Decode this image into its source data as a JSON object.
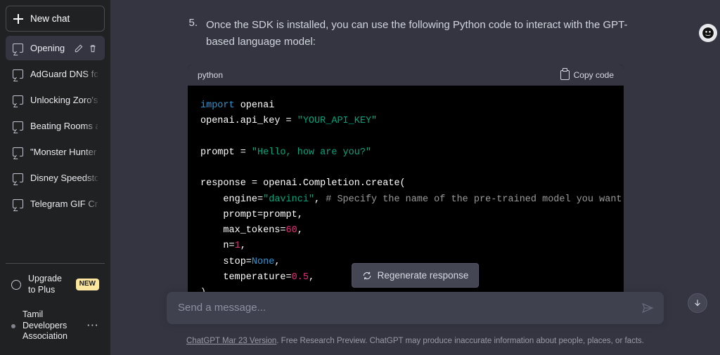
{
  "sidebar": {
    "new_chat_label": "New chat",
    "items": [
      {
        "label": "Opening",
        "active": true
      },
      {
        "label": "AdGuard DNS for"
      },
      {
        "label": "Unlocking Zoro's"
      },
      {
        "label": "Beating Rooms a"
      },
      {
        "label": "\"Monster Hunter"
      },
      {
        "label": "Disney Speedsto"
      },
      {
        "label": "Telegram GIF Cr"
      }
    ],
    "upgrade_label": "Upgrade to Plus",
    "upgrade_badge": "NEW",
    "account_label": "Tamil Developers Association"
  },
  "content": {
    "step_number": "5.",
    "step_text": "Once the SDK is installed, you can use the following Python code to interact with the GPT-based language model:",
    "code_lang": "python",
    "copy_label": "Copy code",
    "code": {
      "l1_kw": "import",
      "l1_name": " openai",
      "l2_a": "openai.api_key = ",
      "l2_str": "\"YOUR_API_KEY\"",
      "l3_a": "prompt = ",
      "l3_str": "\"Hello, how are you?\"",
      "l4": "response = openai.Completion.create(",
      "l5_a": "    engine=",
      "l5_str": "\"davinci\"",
      "l5_b": ", ",
      "l5_cmt": "# Specify the name of the pre-trained model you want to use",
      "l6": "    prompt=prompt,",
      "l7_a": "    max_tokens=",
      "l7_num": "60",
      "l7_b": ",",
      "l8_a": "    n=",
      "l8_num": "1",
      "l8_b": ",",
      "l9_a": "    stop=",
      "l9_none": "None",
      "l9_b": ",",
      "l10_a": "    temperature=",
      "l10_num": "0.5",
      "l10_b": ",",
      "l11": ")"
    }
  },
  "controls": {
    "regenerate_label": "Regenerate response",
    "input_placeholder": "Send a message..."
  },
  "footer": {
    "version_label": "ChatGPT Mar 23 Version",
    "disclaimer": ". Free Research Preview. ChatGPT may produce inaccurate information about people, places, or facts."
  }
}
